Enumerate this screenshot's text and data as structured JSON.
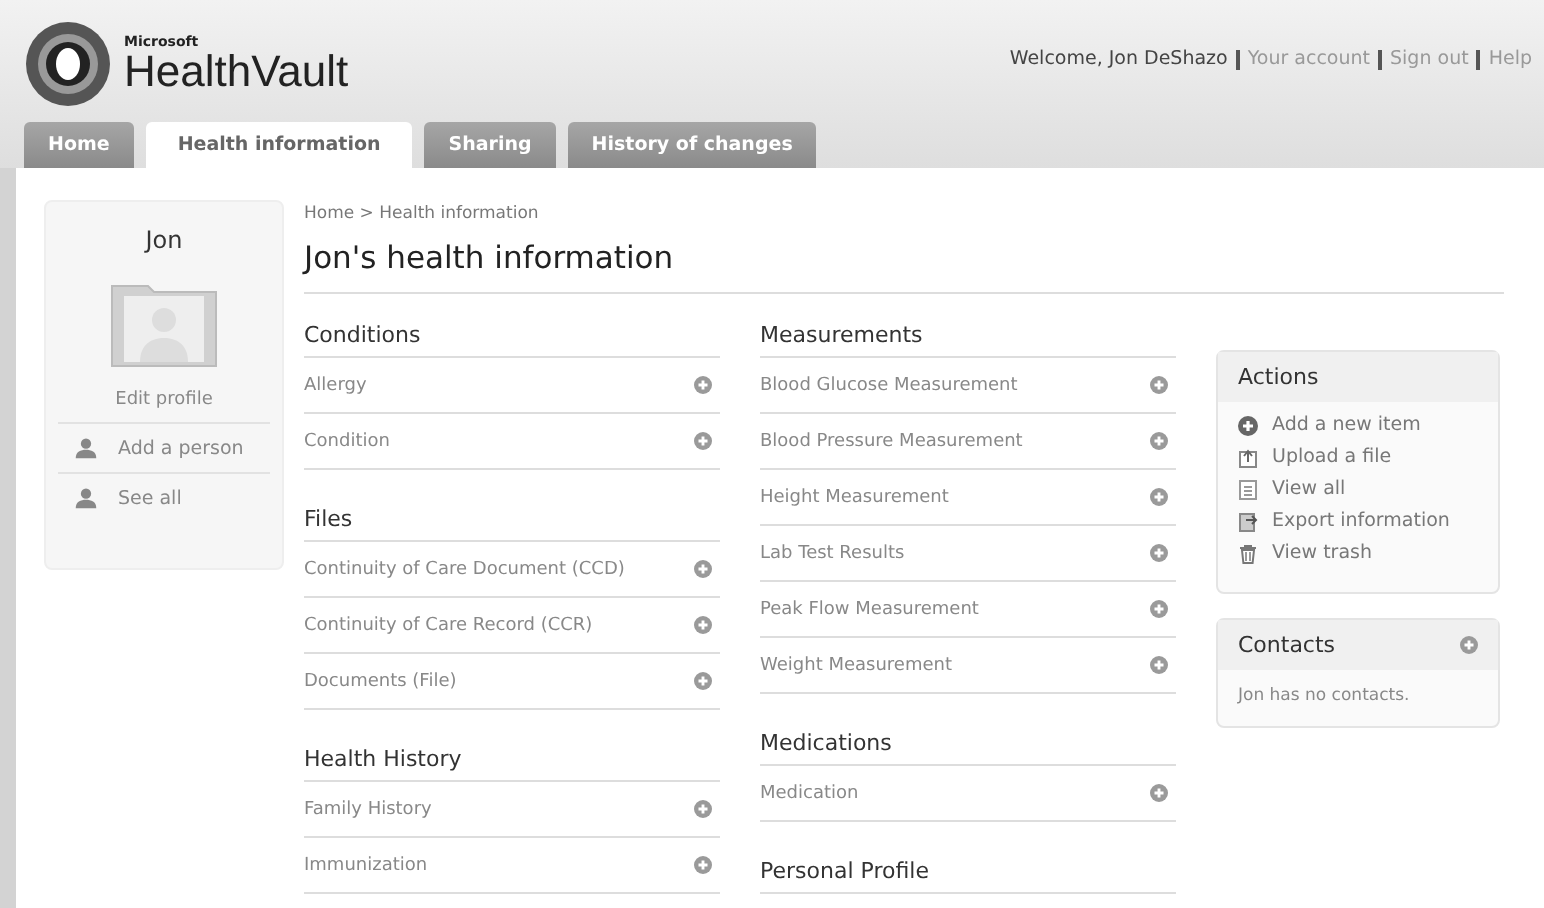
{
  "logo": {
    "brand": "Microsoft",
    "product": "HealthVault"
  },
  "user_bar": {
    "welcome": "Welcome, Jon DeShazo",
    "links": [
      "Your account",
      "Sign out",
      "Help"
    ]
  },
  "tabs": [
    {
      "label": "Home",
      "selected": false
    },
    {
      "label": "Health information",
      "selected": true
    },
    {
      "label": "Sharing",
      "selected": false
    },
    {
      "label": "History of changes",
      "selected": false
    }
  ],
  "profile": {
    "name": "Jon",
    "edit_link": "Edit profile",
    "links": [
      "Add a person",
      "See all"
    ]
  },
  "breadcrumb": "Home > Health information",
  "page_title": "Jon's health information",
  "columns": [
    [
      {
        "title": "Conditions",
        "items": [
          "Allergy",
          "Condition"
        ]
      },
      {
        "title": "Files",
        "items": [
          "Continuity of Care Document (CCD)",
          "Continuity of Care Record (CCR)",
          "Documents (File)"
        ]
      },
      {
        "title": "Health History",
        "items": [
          "Family History",
          "Immunization"
        ]
      }
    ],
    [
      {
        "title": "Measurements",
        "items": [
          "Blood Glucose Measurement",
          "Blood Pressure Measurement",
          "Height Measurement",
          "Lab Test Results",
          "Peak Flow Measurement",
          "Weight Measurement"
        ]
      },
      {
        "title": "Medications",
        "items": [
          "Medication"
        ]
      },
      {
        "title": "Personal Profile"
      }
    ]
  ],
  "actions": {
    "title": "Actions",
    "items": [
      "Add a new item",
      "Upload a file",
      "View all",
      "Export information",
      "View trash"
    ]
  },
  "contacts": {
    "title": "Contacts",
    "empty_text": "Jon has no contacts."
  }
}
